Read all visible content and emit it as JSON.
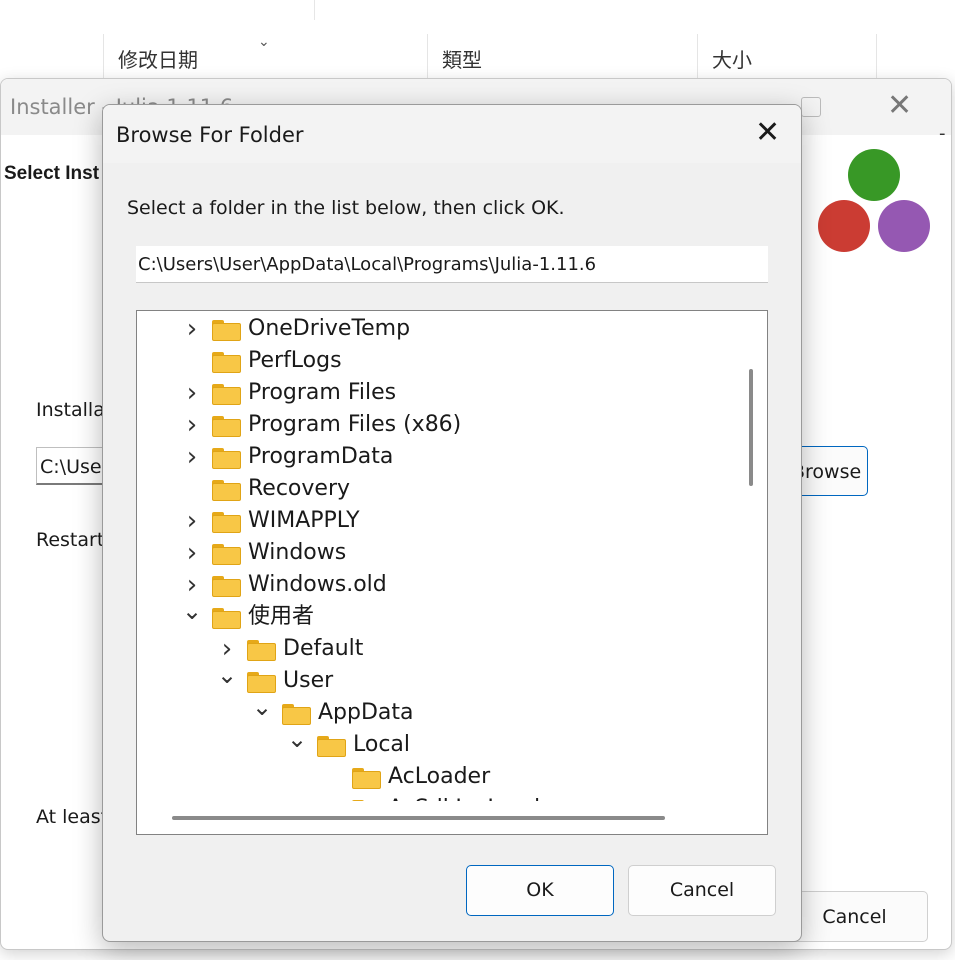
{
  "explorer": {
    "columns": [
      "修改日期",
      "類型",
      "大小"
    ]
  },
  "installer": {
    "title": "Installer - Julia 1.11.6",
    "heading": "Select Inst",
    "install_label": "Installat",
    "path_value": "C:\\User",
    "restart_label": "Restart",
    "at_least_label": "At least",
    "browse_label": "Browse",
    "cancel_label": "Cancel",
    "logo_colors": [
      "#389826",
      "#cb3c33",
      "#9558b2"
    ]
  },
  "dialog": {
    "title": "Browse For Folder",
    "prompt": "Select a folder in the list below, then click OK.",
    "path": "C:\\Users\\User\\AppData\\Local\\Programs\\Julia-1.11.6",
    "tree": [
      {
        "label": "OneDriveTemp",
        "depth": 0,
        "expander": "collapsed"
      },
      {
        "label": "PerfLogs",
        "depth": 0,
        "expander": "none"
      },
      {
        "label": "Program Files",
        "depth": 0,
        "expander": "collapsed"
      },
      {
        "label": "Program Files (x86)",
        "depth": 0,
        "expander": "collapsed"
      },
      {
        "label": "ProgramData",
        "depth": 0,
        "expander": "collapsed"
      },
      {
        "label": "Recovery",
        "depth": 0,
        "expander": "none"
      },
      {
        "label": "WIMAPPLY",
        "depth": 0,
        "expander": "collapsed"
      },
      {
        "label": "Windows",
        "depth": 0,
        "expander": "collapsed"
      },
      {
        "label": "Windows.old",
        "depth": 0,
        "expander": "collapsed"
      },
      {
        "label": "使用者",
        "depth": 0,
        "expander": "expanded"
      },
      {
        "label": "Default",
        "depth": 1,
        "expander": "collapsed"
      },
      {
        "label": "User",
        "depth": 1,
        "expander": "expanded"
      },
      {
        "label": "AppData",
        "depth": 2,
        "expander": "expanded"
      },
      {
        "label": "Local",
        "depth": 3,
        "expander": "expanded"
      },
      {
        "label": "AcLoader",
        "depth": 4,
        "expander": "none"
      },
      {
        "label": "AcSdkInsLoader",
        "depth": 4,
        "expander": "none"
      }
    ],
    "ok_label": "OK",
    "cancel_label": "Cancel"
  }
}
